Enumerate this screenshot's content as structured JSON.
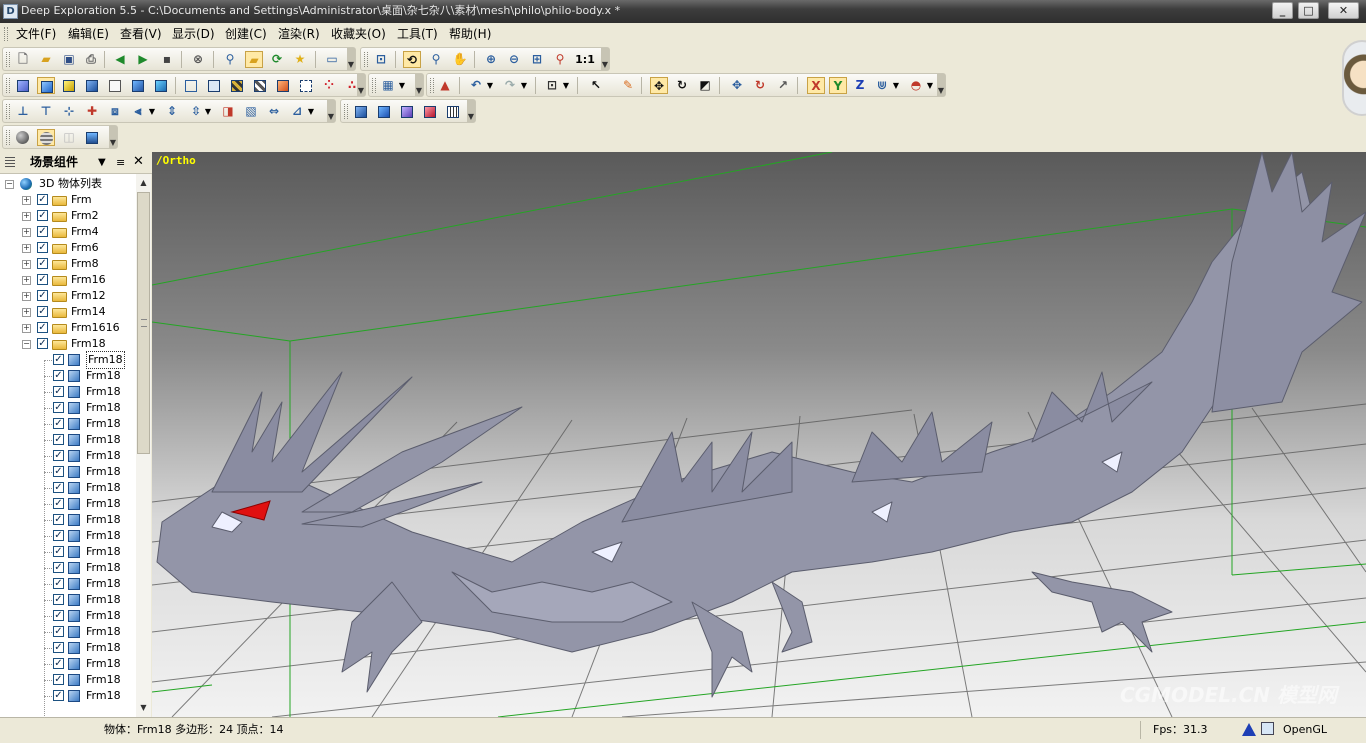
{
  "window": {
    "title": "Deep Exploration 5.5 - C:\\Documents and Settings\\Administrator\\桌面\\杂七杂八\\素材\\mesh\\philo\\philo-body.x *"
  },
  "menu": [
    "文件(F)",
    "编辑(E)",
    "查看(V)",
    "显示(D)",
    "创建(C)",
    "渲染(R)",
    "收藏夹(O)",
    "工具(T)",
    "帮助(H)"
  ],
  "toolbar": {
    "scale_label": "1:1",
    "axis_x": "X",
    "axis_y": "Y",
    "axis_z": "Z"
  },
  "panel": {
    "title": "场景组件",
    "root": "3D 物体列表"
  },
  "tree_frames": [
    "Frm",
    "Frm2",
    "Frm4",
    "Frm6",
    "Frm8",
    "Frm16",
    "Frm12",
    "Frm14",
    "Frm1616",
    "Frm18"
  ],
  "tree_meshes": [
    "Frm18",
    "Frm18",
    "Frm18",
    "Frm18",
    "Frm18",
    "Frm18",
    "Frm18",
    "Frm18",
    "Frm18",
    "Frm18",
    "Frm18",
    "Frm18",
    "Frm18",
    "Frm18",
    "Frm18",
    "Frm18",
    "Frm18",
    "Frm18",
    "Frm18",
    "Frm18",
    "Frm18",
    "Frm18"
  ],
  "viewport": {
    "view_label": "/Ortho",
    "watermark": "CGMODEL.CN 模型网"
  },
  "status": {
    "info": "物体：Frm18 多边形：24 顶点：14",
    "fps": "Fps：31.3",
    "renderer": "OpenGL"
  },
  "colors": {
    "titlebar": "#3d3d3d",
    "chrome": "#ece9d8",
    "grid_green": "#24a524",
    "model": "#9395a8",
    "eye": "#e01010",
    "view_label": "#ffff00"
  }
}
